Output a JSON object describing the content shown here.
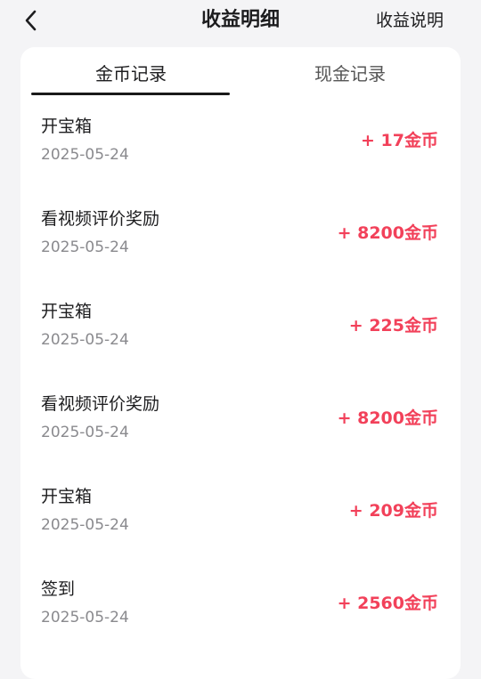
{
  "header": {
    "back_icon": "chevron-left-icon",
    "title": "收益明细",
    "help_label": "收益说明"
  },
  "tabs": [
    {
      "label": "金币记录",
      "active": true
    },
    {
      "label": "现金记录",
      "active": false
    }
  ],
  "records": [
    {
      "title": "开宝箱",
      "date": "2025-05-24",
      "amount": "+ 17金币"
    },
    {
      "title": "看视频评价奖励",
      "date": "2025-05-24",
      "amount": "+ 8200金币"
    },
    {
      "title": "开宝箱",
      "date": "2025-05-24",
      "amount": "+ 225金币"
    },
    {
      "title": "看视频评价奖励",
      "date": "2025-05-24",
      "amount": "+ 8200金币"
    },
    {
      "title": "开宝箱",
      "date": "2025-05-24",
      "amount": "+ 209金币"
    },
    {
      "title": "签到",
      "date": "2025-05-24",
      "amount": "+ 2560金币"
    }
  ],
  "colors": {
    "amount": "#f2415a",
    "background": "#f4f4f6",
    "card": "#ffffff"
  }
}
